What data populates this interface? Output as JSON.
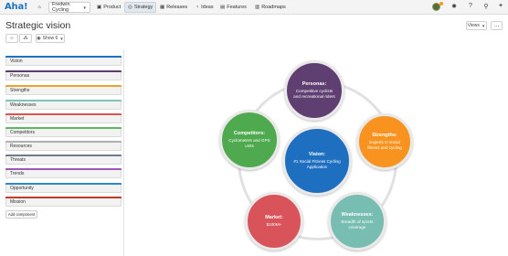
{
  "nav": {
    "logo": "Aha!",
    "product": "Fredwin Cycling",
    "items": [
      "Product",
      "Strategy",
      "Releases",
      "Ideas",
      "Features",
      "Roadmaps"
    ]
  },
  "header": {
    "title": "Strategic vision",
    "show_label": "Show 6",
    "views_label": "Views",
    "more_label": "…"
  },
  "components": [
    {
      "label": "Vision",
      "color": "#1e73be"
    },
    {
      "label": "Personas",
      "color": "#5d3b6e"
    },
    {
      "label": "Strengths",
      "color": "#f0a030"
    },
    {
      "label": "Weaknesses",
      "color": "#7fc2b8"
    },
    {
      "label": "Market",
      "color": "#d9534f"
    },
    {
      "label": "Competitors",
      "color": "#5cb85c"
    },
    {
      "label": "Resources",
      "color": "#b0b0b0"
    },
    {
      "label": "Threats",
      "color": "#6e7b8b"
    },
    {
      "label": "Trends",
      "color": "#9b59b6"
    },
    {
      "label": "Opportunity",
      "color": "#2f86c8"
    },
    {
      "label": "Mission",
      "color": "#c0392b"
    }
  ],
  "add_component": "Add component",
  "diagram": {
    "personas": {
      "title": "Personas:",
      "desc": "Competitive cyclists and recreational riders",
      "color": "#5f3f72"
    },
    "strengths": {
      "title": "Strengths:",
      "desc": "Experts in social fitness and cycling",
      "color": "#f7931e"
    },
    "weaknesses": {
      "title": "Weaknesses:",
      "desc": "Breadth of sports coverage",
      "color": "#78bdb2"
    },
    "market": {
      "title": "Market:",
      "desc": "$100M+",
      "color": "#d9535a"
    },
    "competitors": {
      "title": "Competitors:",
      "desc": "Cyclometers and GPS units",
      "color": "#4faa4f"
    },
    "vision": {
      "title": "Vision:",
      "desc": "#1 Social Fitness Cycling Application",
      "color": "#1f6fc1"
    }
  }
}
